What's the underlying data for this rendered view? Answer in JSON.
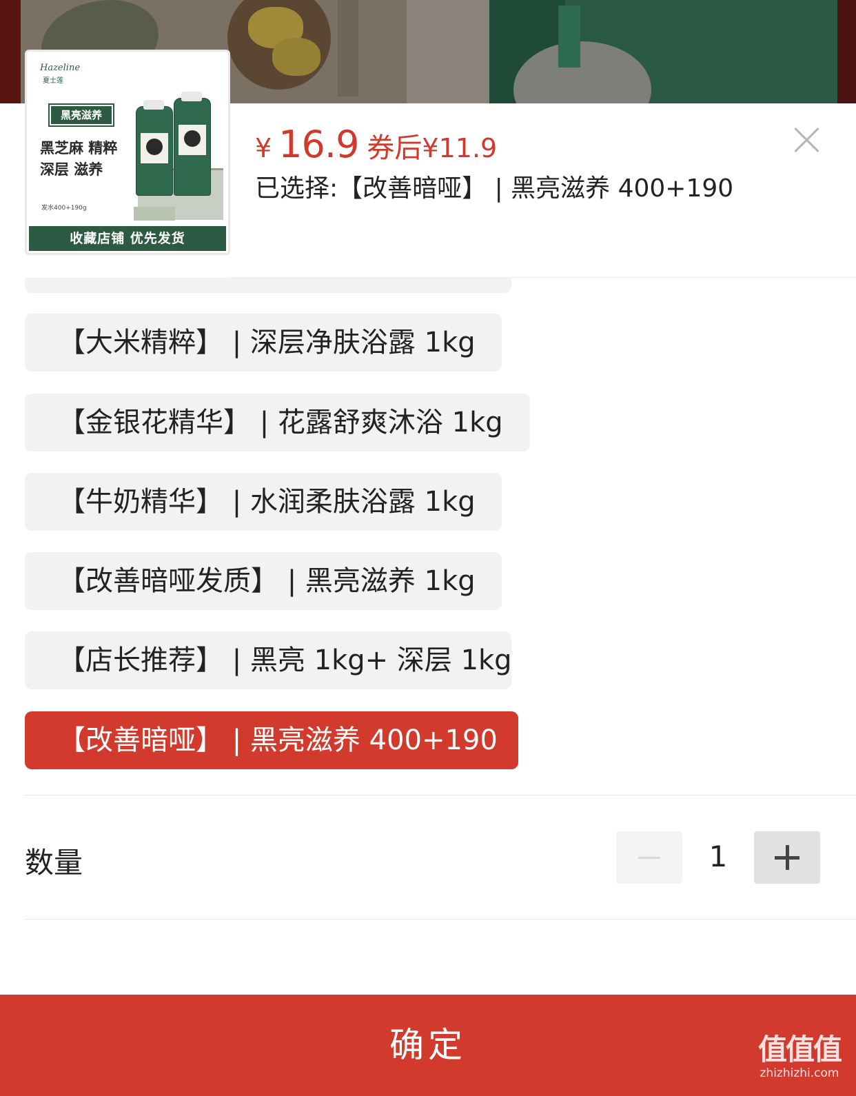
{
  "product": {
    "thumbnail": {
      "brand": "Hazeline",
      "brand_cn": "夏士莲",
      "tag": "黑亮滋养",
      "title_line1": "黑芝麻 精粹",
      "title_line2": "深层 滋养",
      "spec": "发水400+190g",
      "footer": "收藏店铺  优先发货"
    },
    "price_symbol": "¥",
    "price": "16.9",
    "coupon_label": "券后",
    "coupon_price": "¥11.9",
    "selected_text": "已选择:【改善暗哑】 | 黑亮滋养 400+190"
  },
  "options": [
    {
      "label": "【大米精粹】 | 深层净肤浴露 1kg",
      "selected": false
    },
    {
      "label": "【金银花精华】 | 花露舒爽沐浴 1kg",
      "selected": false
    },
    {
      "label": "【牛奶精华】 | 水润柔肤浴露 1kg",
      "selected": false
    },
    {
      "label": "【改善暗哑发质】 | 黑亮滋养 1kg",
      "selected": false
    },
    {
      "label": "【店长推荐】 | 黑亮 1kg+ 深层 1kg",
      "selected": false
    },
    {
      "label": "【改善暗哑】 | 黑亮滋养 400+190",
      "selected": true
    }
  ],
  "quantity": {
    "label": "数量",
    "value": "1"
  },
  "confirm_label": "确定",
  "watermark": {
    "logo": "值值值",
    "domain": "zhizhizhi.com"
  },
  "colors": {
    "accent": "#d23a2e",
    "price": "#d1392c",
    "option_bg": "#f2f2f2",
    "thumb_green": "#2c5a43"
  },
  "icons": {
    "close": "close-icon",
    "minus": "minus-icon",
    "plus": "plus-icon"
  }
}
